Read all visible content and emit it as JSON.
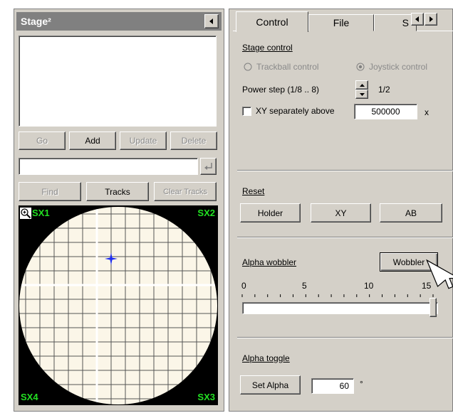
{
  "left_panel": {
    "title": "Stage²",
    "buttons": {
      "go": "Go",
      "add": "Add",
      "update": "Update",
      "delete": "Delete",
      "find": "Find",
      "tracks": "Tracks",
      "clear_tracks": "Clear Tracks"
    },
    "find_input_value": "",
    "map": {
      "labels": {
        "tl": "SX1",
        "tr": "SX2",
        "bl": "SX4",
        "br": "SX3"
      }
    }
  },
  "right_panel": {
    "tabs": [
      {
        "label": "Control",
        "active": true
      },
      {
        "label": "File",
        "active": false
      },
      {
        "label": "S",
        "active": false
      }
    ],
    "stage_control": {
      "heading": "Stage control",
      "trackball_label": "Trackball control",
      "joystick_label": "Joystick control",
      "power_step_label": "Power step (1/8 .. 8)",
      "power_step_value": "1/2",
      "xy_separately_label": "XY separately above",
      "xy_separately_value": "500000",
      "xy_separately_unit": "x",
      "xy_separately_checked": false
    },
    "reset": {
      "heading": "Reset",
      "holder": "Holder",
      "xy": "XY",
      "ab": "AB"
    },
    "alpha_wobbler": {
      "heading": "Alpha wobbler",
      "button": "Wobbler",
      "scale_labels": [
        "0",
        "5",
        "10",
        "15"
      ],
      "slider_value": 15,
      "slider_max": 15
    },
    "alpha_toggle": {
      "heading": "Alpha toggle",
      "button": "Set Alpha",
      "value": "60",
      "unit": "°"
    }
  },
  "colors": {
    "panel": "#d4d0c8",
    "title_bar": "#808080",
    "map_bg": "#000000",
    "map_disc": "#fbf6e8",
    "map_label": "#22e022",
    "cursor": "#1c2cf0"
  }
}
